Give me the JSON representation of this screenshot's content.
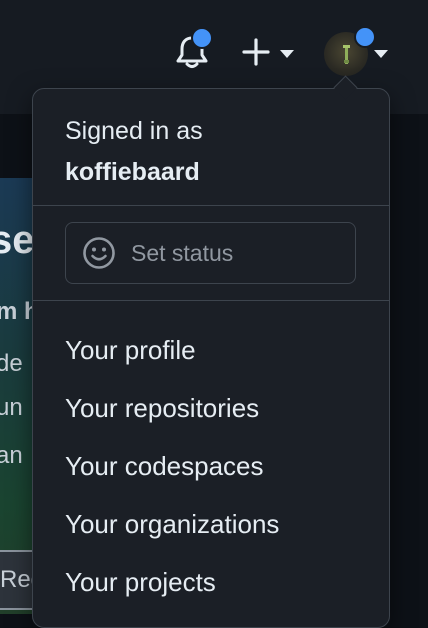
{
  "header": {
    "icons": [
      "bell-icon",
      "plus-icon",
      "avatar"
    ],
    "accent": "#4493f8"
  },
  "background": {
    "fragment_lines": [
      "se",
      "m h",
      "de",
      "un",
      "an"
    ],
    "register_fragment": "Reg"
  },
  "dropdown": {
    "signed_in_label": "Signed in as",
    "username": "koffiebaard",
    "status_placeholder": "Set status",
    "menu": [
      {
        "label": "Your profile"
      },
      {
        "label": "Your repositories"
      },
      {
        "label": "Your codespaces"
      },
      {
        "label": "Your organizations"
      },
      {
        "label": "Your projects"
      }
    ]
  }
}
